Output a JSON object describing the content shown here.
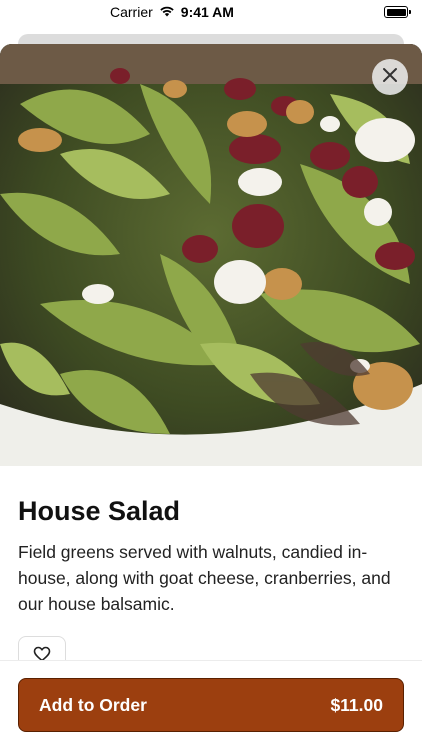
{
  "status_bar": {
    "carrier": "Carrier",
    "time": "9:41 AM"
  },
  "item": {
    "title": "House Salad",
    "description": "Field greens served with walnuts, candied in-house, along with goat cheese, cranberries, and our house balsamic.",
    "image_alt": "House Salad"
  },
  "actions": {
    "add_label": "Add to Order",
    "price": "$11.00",
    "close_icon": "close-icon",
    "favorite_icon": "heart-icon"
  },
  "colors": {
    "accent": "#9c3f0f",
    "accent_border": "#5a2000",
    "text": "#111111"
  }
}
